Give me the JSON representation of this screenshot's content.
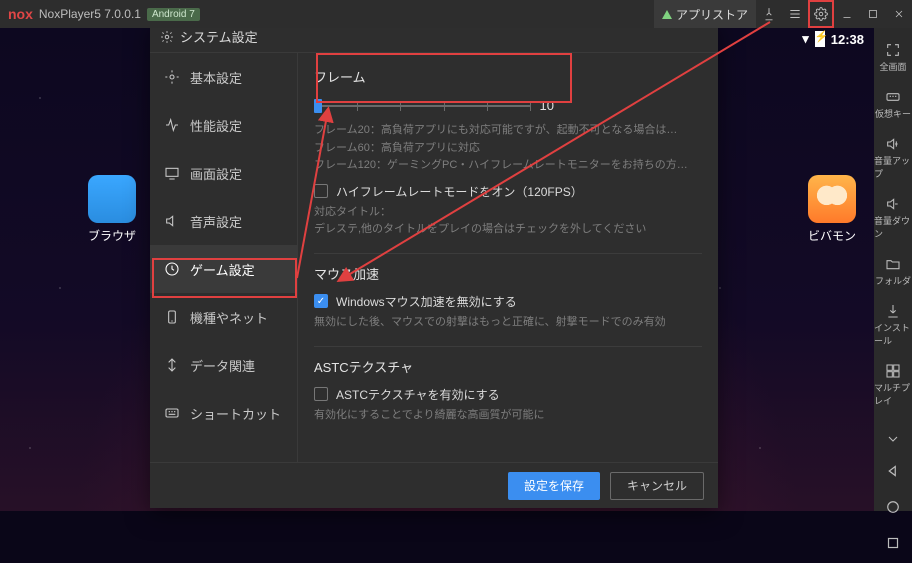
{
  "titlebar": {
    "brand": "nox",
    "app": "NoxPlayer5 7.0.0.1",
    "android_badge": "Android 7",
    "appstore_label": "アプリストア"
  },
  "statusbar": {
    "clock": "12:38"
  },
  "desktop": {
    "browser_label": "ブラウザ",
    "vivamon_label": "ビバモン"
  },
  "rightbar": {
    "items": [
      {
        "name": "fullscreen",
        "label": "全画面"
      },
      {
        "name": "virtualkey",
        "label": "仮想キー"
      },
      {
        "name": "volumeup",
        "label": "音量アップ"
      },
      {
        "name": "volumedown",
        "label": "音量ダウン"
      },
      {
        "name": "folder",
        "label": "フォルダ"
      },
      {
        "name": "install",
        "label": "インストール"
      },
      {
        "name": "multiplay",
        "label": "マルチプレイ"
      }
    ]
  },
  "dialog": {
    "title": "システム設定",
    "side": [
      {
        "key": "basic",
        "label": "基本設定"
      },
      {
        "key": "perf",
        "label": "性能設定"
      },
      {
        "key": "screen",
        "label": "画面設定"
      },
      {
        "key": "audio",
        "label": "音声設定"
      },
      {
        "key": "game",
        "label": "ゲーム設定"
      },
      {
        "key": "device",
        "label": "機種やネット"
      },
      {
        "key": "data",
        "label": "データ関連"
      },
      {
        "key": "shortcut",
        "label": "ショートカット"
      }
    ],
    "frame": {
      "title": "フレーム",
      "value": "10",
      "hints": [
        "フレーム20：高負荷アプリにも対応可能ですが、起動不可となる場合は…",
        "フレーム60：高負荷アプリに対応",
        "フレーム120：ゲーミングPC・ハイフレームレートモニターをお持ちの方…"
      ],
      "hfr_checkbox": "ハイフレームレートモードをオン（120FPS）",
      "hfr_note1": "対応タイトル：",
      "hfr_note2": "デレステ,他のタイトルをプレイの場合はチェックを外してください"
    },
    "mouse": {
      "title": "マウス加速",
      "checkbox": "Windowsマウス加速を無効にする",
      "note": "無効にした後、マウスでの射撃はもっと正確に、射撃モードでのみ有効"
    },
    "astc": {
      "title": "ASTCテクスチャ",
      "checkbox": "ASTCテクスチャを有効にする",
      "note": "有効化にすることでより綺麗な高画質が可能に"
    },
    "footer": {
      "save": "設定を保存",
      "cancel": "キャンセル"
    }
  }
}
